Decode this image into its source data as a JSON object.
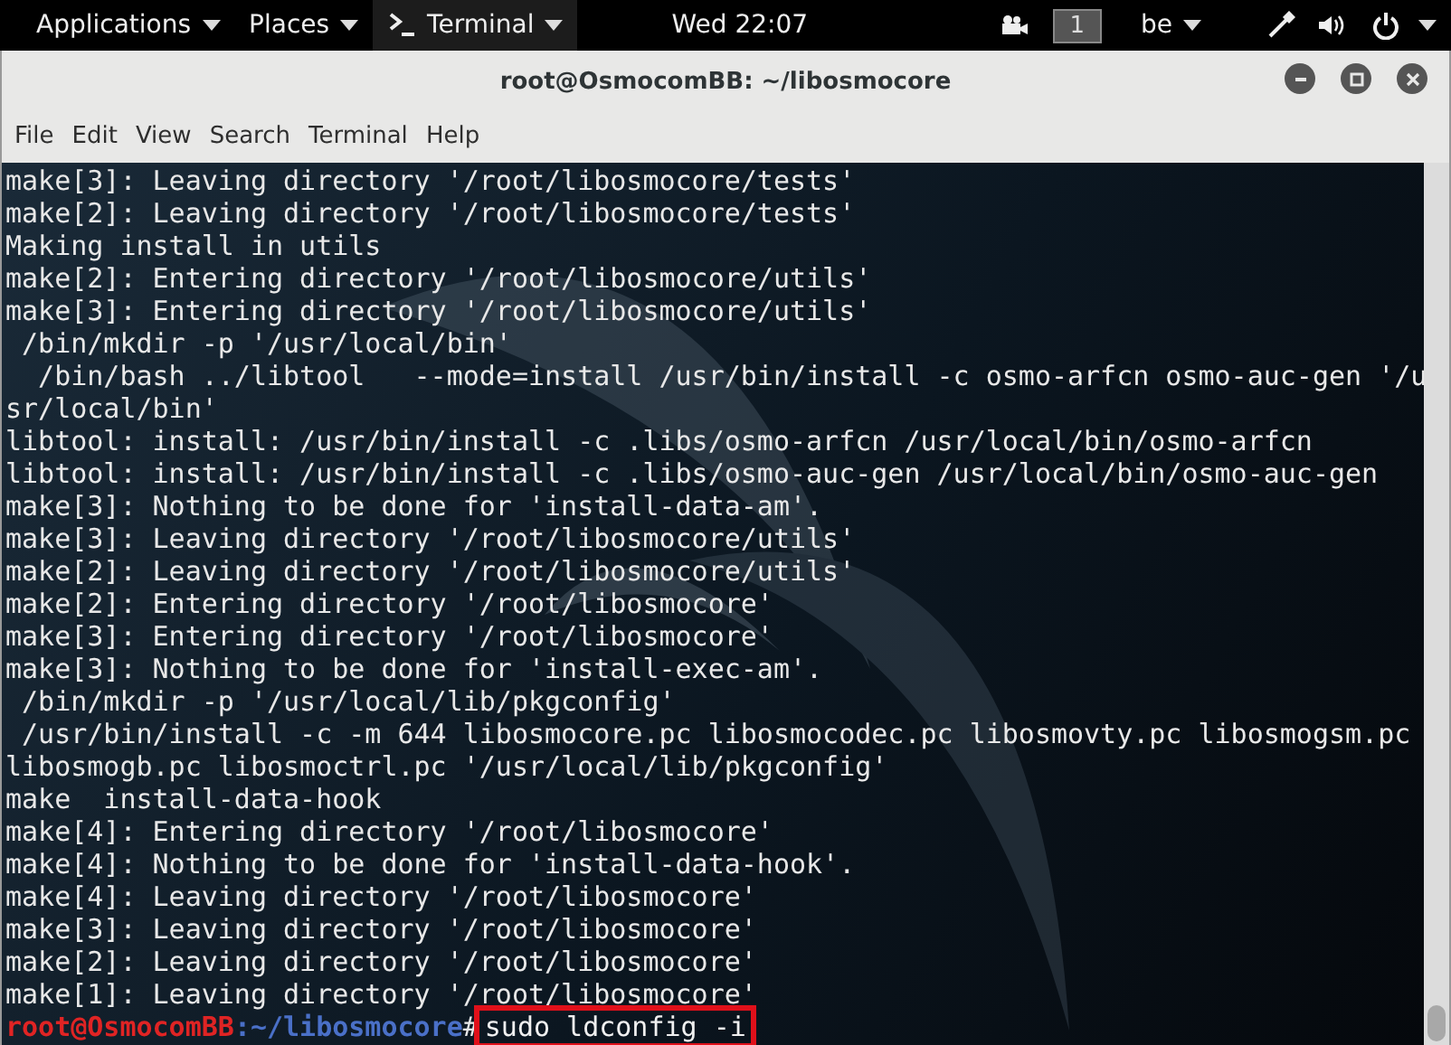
{
  "top_bar": {
    "menus": [
      {
        "label": "Applications",
        "kind": "menu"
      },
      {
        "label": "Places",
        "kind": "menu"
      },
      {
        "label": "Terminal",
        "kind": "app"
      }
    ],
    "clock": "Wed 22:07",
    "workspace": "1",
    "keyboard": "be"
  },
  "window": {
    "title": "root@OsmocomBB: ~/libosmocore"
  },
  "menu_bar": [
    "File",
    "Edit",
    "View",
    "Search",
    "Terminal",
    "Help"
  ],
  "terminal": {
    "lines": [
      "make[3]: Leaving directory '/root/libosmocore/tests'",
      "make[2]: Leaving directory '/root/libosmocore/tests'",
      "Making install in utils",
      "make[2]: Entering directory '/root/libosmocore/utils'",
      "make[3]: Entering directory '/root/libosmocore/utils'",
      " /bin/mkdir -p '/usr/local/bin'",
      "  /bin/bash ../libtool   --mode=install /usr/bin/install -c osmo-arfcn osmo-auc-gen '/u",
      "sr/local/bin'",
      "libtool: install: /usr/bin/install -c .libs/osmo-arfcn /usr/local/bin/osmo-arfcn",
      "libtool: install: /usr/bin/install -c .libs/osmo-auc-gen /usr/local/bin/osmo-auc-gen",
      "make[3]: Nothing to be done for 'install-data-am'.",
      "make[3]: Leaving directory '/root/libosmocore/utils'",
      "make[2]: Leaving directory '/root/libosmocore/utils'",
      "make[2]: Entering directory '/root/libosmocore'",
      "make[3]: Entering directory '/root/libosmocore'",
      "make[3]: Nothing to be done for 'install-exec-am'.",
      " /bin/mkdir -p '/usr/local/lib/pkgconfig'",
      " /usr/bin/install -c -m 644 libosmocore.pc libosmocodec.pc libosmovty.pc libosmogsm.pc",
      "libosmogb.pc libosmoctrl.pc '/usr/local/lib/pkgconfig'",
      "make  install-data-hook",
      "make[4]: Entering directory '/root/libosmocore'",
      "make[4]: Nothing to be done for 'install-data-hook'.",
      "make[4]: Leaving directory '/root/libosmocore'",
      "make[3]: Leaving directory '/root/libosmocore'",
      "make[2]: Leaving directory '/root/libosmocore'",
      "make[1]: Leaving directory '/root/libosmocore'"
    ],
    "prompt": {
      "user_host": "root@OsmocomBB",
      "path": ":~/libosmocore",
      "symbol": "#",
      "command": "sudo ldconfig -i",
      "highlighted": true
    }
  }
}
